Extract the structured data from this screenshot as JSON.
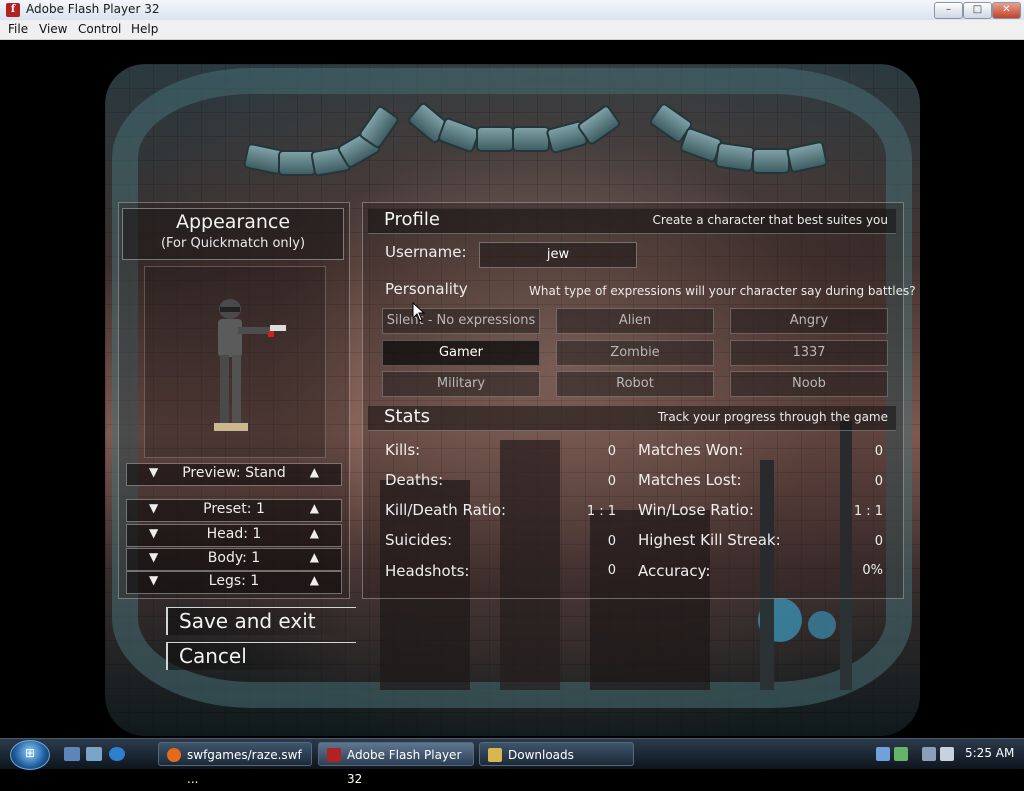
{
  "window": {
    "title": "Adobe Flash Player 32",
    "app_icon": "flash-icon",
    "controls": [
      "minimize-icon",
      "maximize-icon",
      "close-icon"
    ]
  },
  "menu": [
    "File",
    "View",
    "Control",
    "Help"
  ],
  "appearance": {
    "title": "Appearance",
    "subtitle": "(For Quickmatch only)",
    "preview": "Preview: Stand",
    "preset": "Preset: 1",
    "head": "Head: 1",
    "body": "Body: 1",
    "legs": "Legs: 1"
  },
  "profile": {
    "title": "Profile",
    "description": "Create a character that best suites you",
    "username_label": "Username:",
    "username_value": "jew"
  },
  "personality": {
    "title": "Personality",
    "description": "What type of expressions will your character say during battles?",
    "options": [
      "Silent - No expressions",
      "Alien",
      "Angry",
      "Gamer",
      "Zombie",
      "1337",
      "Military",
      "Robot",
      "Noob"
    ],
    "selected": "Gamer"
  },
  "stats": {
    "title": "Stats",
    "description": "Track your progress through the game",
    "left": [
      {
        "label": "Kills:",
        "value": "0"
      },
      {
        "label": "Deaths:",
        "value": "0"
      },
      {
        "label": "Kill/Death Ratio:",
        "value": "1 : 1"
      },
      {
        "label": "Suicides:",
        "value": "0"
      },
      {
        "label": "Headshots:",
        "value": "0"
      }
    ],
    "right": [
      {
        "label": "Matches Won:",
        "value": "0"
      },
      {
        "label": "Matches Lost:",
        "value": "0"
      },
      {
        "label": "Win/Lose Ratio:",
        "value": "1 : 1"
      },
      {
        "label": "Highest Kill Streak:",
        "value": "0"
      },
      {
        "label": "Accuracy:",
        "value": "0%"
      }
    ]
  },
  "actions": {
    "save": "Save and exit",
    "cancel": "Cancel"
  },
  "taskbar": {
    "start_icon": "windows-logo-icon",
    "tasks": [
      {
        "label": "swfgames/raze.swf ...",
        "icon": "firefox-icon"
      },
      {
        "label": "Adobe Flash Player 32",
        "icon": "flash-icon",
        "active": true
      },
      {
        "label": "Downloads",
        "icon": "folder-icon"
      }
    ],
    "clock": "5:25 AM"
  }
}
